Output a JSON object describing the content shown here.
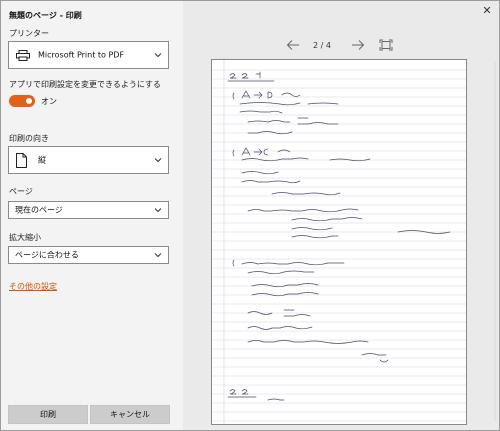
{
  "window": {
    "title": "無題のページ - 印刷",
    "close": "✕"
  },
  "printer": {
    "label": "プリンター",
    "selected": "Microsoft Print to PDF"
  },
  "app_settings": {
    "label": "アプリで印刷設定を変更できるようにする",
    "toggle_state": "オン",
    "toggle_on": true
  },
  "orientation": {
    "label": "印刷の向き",
    "selected": "縦"
  },
  "pages": {
    "label": "ページ",
    "selected": "現在のページ"
  },
  "scale": {
    "label": "拡大縮小",
    "selected": "ページに合わせる"
  },
  "more_settings": "その他の設定",
  "buttons": {
    "print": "印刷",
    "cancel": "キャンセル"
  },
  "preview": {
    "page_indicator": "2 / 4"
  },
  "colors": {
    "accent": "#e0611a",
    "link": "#d35400",
    "ruled_line": "#c9d3ea",
    "ink": "#4a4a6a"
  }
}
